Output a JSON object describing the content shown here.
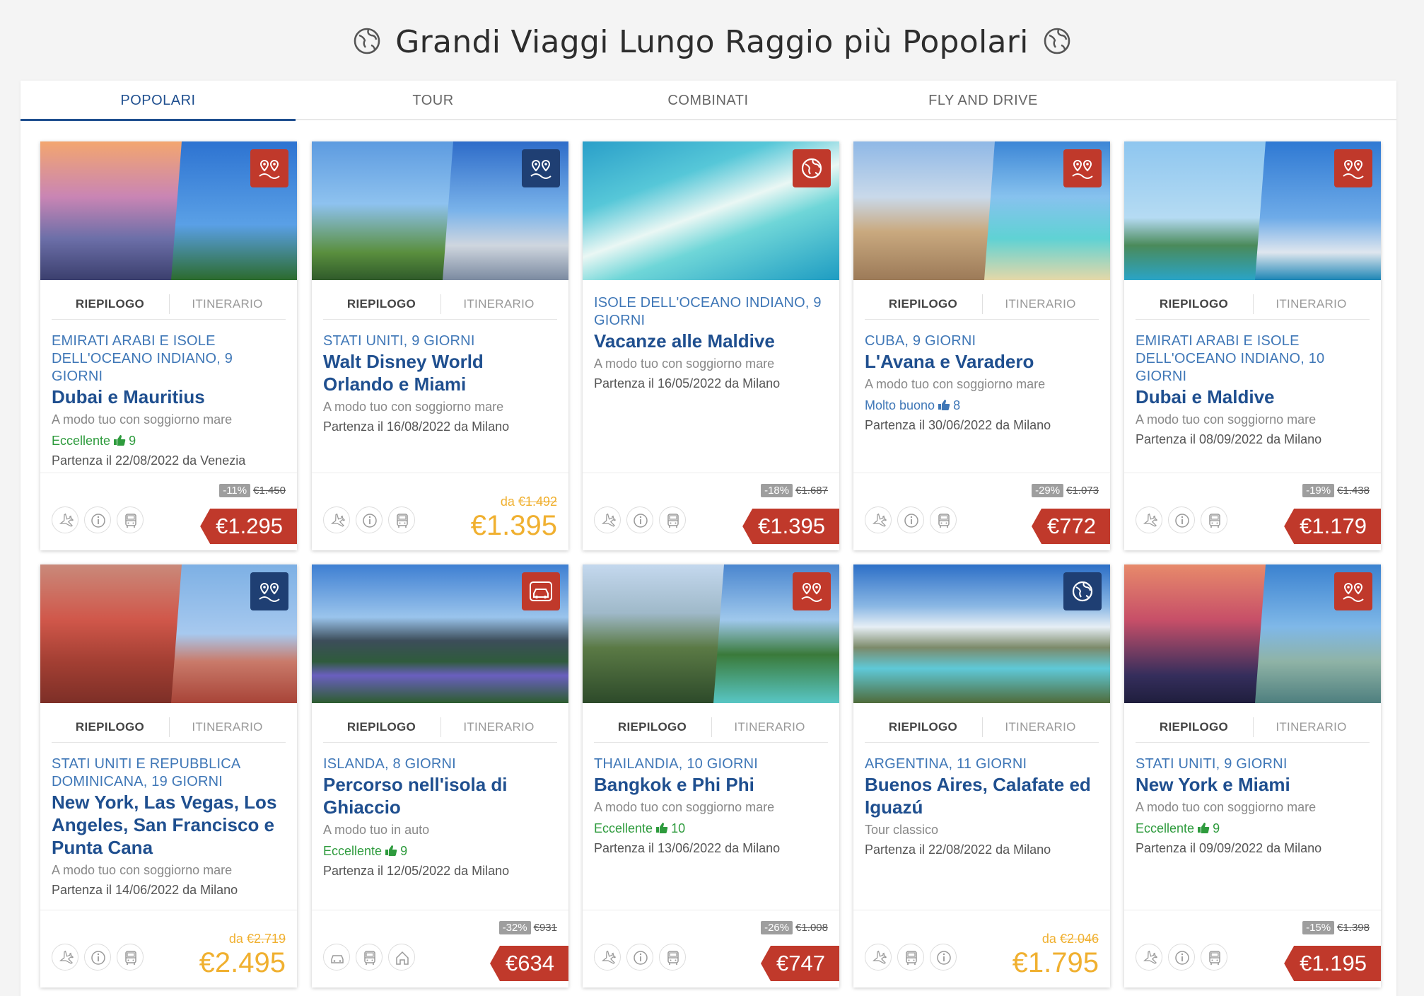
{
  "page": {
    "title": "Grandi Viaggi Lungo Raggio più Popolari",
    "title_icon": "globe-icon"
  },
  "tabs": [
    {
      "label": "POPOLARI",
      "active": true
    },
    {
      "label": "TOUR",
      "active": false
    },
    {
      "label": "COMBINATI",
      "active": false
    },
    {
      "label": "FLY AND DRIVE",
      "active": false
    }
  ],
  "card_tabs": {
    "summary": "RIEPILOGO",
    "itinerary": "ITINERARIO"
  },
  "cards": [
    {
      "dest": "EMIRATI ARABI E ISOLE DELL'OCEANO INDIANO, 9 GIORNI",
      "name": "Dubai e Mauritius",
      "mode": "A modo tuo con soggiorno mare",
      "rating_label": "Eccellente",
      "rating_value": "9",
      "rating_color": "#2e9b3d",
      "departure": "Partenza il 22/08/2022 da Venezia",
      "badge": "map-pins-icon",
      "badge_color": "red",
      "discount": "-11%",
      "old_price": "€1.450",
      "price": "€1.295",
      "price_style": "tag",
      "services": [
        "plane-icon",
        "info-icon",
        "bus-icon"
      ],
      "show_tabs": true
    },
    {
      "dest": "STATI UNITI, 9 GIORNI",
      "name": "Walt Disney World Orlando e Miami",
      "mode": "A modo tuo con soggiorno mare",
      "rating_label": "",
      "rating_value": "",
      "departure": "Partenza il 16/08/2022 da Milano",
      "badge": "map-pins-icon",
      "badge_color": "blue",
      "from_label": "da",
      "old_price": "€1.492",
      "price": "€1.395",
      "price_style": "yellow",
      "services": [
        "plane-icon",
        "info-icon",
        "bus-icon"
      ],
      "show_tabs": true
    },
    {
      "dest": "ISOLE DELL'OCEANO INDIANO, 9 GIORNI",
      "name": "Vacanze alle Maldive",
      "mode": "A modo tuo con soggiorno mare",
      "rating_label": "",
      "rating_value": "",
      "departure": "Partenza il 16/05/2022 da Milano",
      "badge": "globe-icon",
      "badge_color": "red",
      "discount": "-18%",
      "old_price": "€1.687",
      "price": "€1.395",
      "price_style": "tag",
      "services": [
        "plane-icon",
        "info-icon",
        "bus-icon"
      ],
      "show_tabs": false
    },
    {
      "dest": "CUBA, 9 GIORNI",
      "name": "L'Avana e Varadero",
      "mode": "A modo tuo con soggiorno mare",
      "rating_label": "Molto buono",
      "rating_value": "8",
      "rating_color": "#3f77b7",
      "departure": "Partenza il 30/06/2022 da Milano",
      "badge": "map-pins-icon",
      "badge_color": "red",
      "discount": "-29%",
      "old_price": "€1.073",
      "price": "€772",
      "price_style": "tag",
      "services": [
        "plane-icon",
        "info-icon",
        "bus-icon"
      ],
      "show_tabs": true
    },
    {
      "dest": "EMIRATI ARABI E ISOLE DELL'OCEANO INDIANO, 10 GIORNI",
      "name": "Dubai e Maldive",
      "mode": "A modo tuo con soggiorno mare",
      "rating_label": "",
      "rating_value": "",
      "departure": "Partenza il 08/09/2022 da Milano",
      "badge": "map-pins-icon",
      "badge_color": "red",
      "discount": "-19%",
      "old_price": "€1.438",
      "price": "€1.179",
      "price_style": "tag",
      "services": [
        "plane-icon",
        "info-icon",
        "bus-icon"
      ],
      "show_tabs": true
    },
    {
      "dest": "STATI UNITI E REPUBBLICA DOMINICANA, 19 GIORNI",
      "name": "New York, Las Vegas, Los Angeles, San Francisco e Punta Cana",
      "mode": "A modo tuo con soggiorno mare",
      "rating_label": "",
      "rating_value": "",
      "departure": "Partenza il 14/06/2022 da Milano",
      "badge": "map-pins-icon",
      "badge_color": "blue",
      "from_label": "da",
      "old_price": "€2.719",
      "price": "€2.495",
      "price_style": "yellow",
      "services": [
        "plane-icon",
        "info-icon",
        "bus-icon"
      ],
      "show_tabs": true
    },
    {
      "dest": "ISLANDA, 8 GIORNI",
      "name": "Percorso nell'isola di Ghiaccio",
      "mode": "A modo tuo in auto",
      "rating_label": "Eccellente",
      "rating_value": "9",
      "rating_color": "#2e9b3d",
      "departure": "Partenza il 12/05/2022 da Milano",
      "badge": "car-icon",
      "badge_color": "red",
      "discount": "-32%",
      "old_price": "€931",
      "price": "€634",
      "price_style": "tag",
      "services": [
        "car-icon",
        "bus-icon",
        "house-icon"
      ],
      "show_tabs": true
    },
    {
      "dest": "THAILANDIA, 10 GIORNI",
      "name": "Bangkok e Phi Phi",
      "mode": "A modo tuo con soggiorno mare",
      "rating_label": "Eccellente",
      "rating_value": "10",
      "rating_color": "#2e9b3d",
      "departure": "Partenza il 13/06/2022 da Milano",
      "badge": "map-pins-icon",
      "badge_color": "red",
      "discount": "-26%",
      "old_price": "€1.008",
      "price": "€747",
      "price_style": "tag",
      "services": [
        "plane-icon",
        "info-icon",
        "bus-icon"
      ],
      "show_tabs": true
    },
    {
      "dest": "ARGENTINA, 11 GIORNI",
      "name": "Buenos Aires, Calafate ed Iguazú",
      "mode": "Tour classico",
      "rating_label": "",
      "rating_value": "",
      "departure": "Partenza il 22/08/2022 da Milano",
      "badge": "globe-icon",
      "badge_color": "blue",
      "from_label": "da",
      "old_price": "€2.046",
      "price": "€1.795",
      "price_style": "yellow",
      "services": [
        "plane-icon",
        "bus-icon",
        "info-icon"
      ],
      "show_tabs": true
    },
    {
      "dest": "STATI UNITI, 9 GIORNI",
      "name": "New York e Miami",
      "mode": "A modo tuo con soggiorno mare",
      "rating_label": "Eccellente",
      "rating_value": "9",
      "rating_color": "#2e9b3d",
      "departure": "Partenza il 09/09/2022 da Milano",
      "badge": "map-pins-icon",
      "badge_color": "red",
      "discount": "-15%",
      "old_price": "€1.398",
      "price": "€1.195",
      "price_style": "tag",
      "services": [
        "plane-icon",
        "info-icon",
        "bus-icon"
      ],
      "show_tabs": true
    }
  ]
}
